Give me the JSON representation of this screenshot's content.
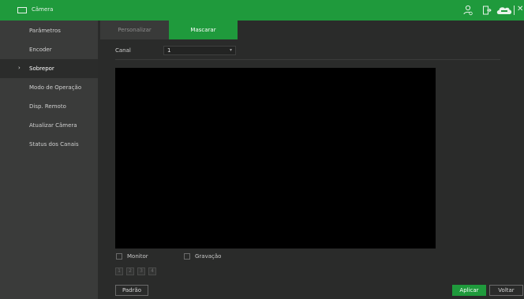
{
  "header": {
    "title": "Câmera",
    "icons": [
      "window-icon",
      "user-icon",
      "exit-icon",
      "cloud-icon",
      "close-icon"
    ],
    "accent_color": "#1f9a3c"
  },
  "sidebar": {
    "items": [
      {
        "label": "Parâmetros",
        "active": false
      },
      {
        "label": "Encoder",
        "active": false
      },
      {
        "label": "Sobrepor",
        "active": true
      },
      {
        "label": "Modo de Operação",
        "active": false
      },
      {
        "label": "Disp. Remoto",
        "active": false
      },
      {
        "label": "Atualizar Câmera",
        "active": false
      },
      {
        "label": "Status dos Canais",
        "active": false
      }
    ]
  },
  "tabs": [
    {
      "label": "Personalizar",
      "active": false
    },
    {
      "label": "Mascarar",
      "active": true
    }
  ],
  "form": {
    "canal_label": "Canal",
    "canal_value": "1"
  },
  "options": {
    "monitor_label": "Monitor",
    "monitor_checked": false,
    "gravacao_label": "Gravação",
    "gravacao_checked": false
  },
  "area_buttons": [
    "1",
    "2",
    "3",
    "4"
  ],
  "footer": {
    "default_label": "Padrão",
    "apply_label": "Aplicar",
    "back_label": "Voltar"
  }
}
